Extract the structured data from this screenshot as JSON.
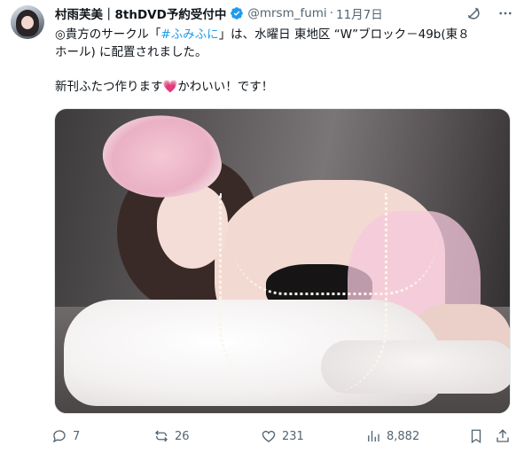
{
  "tweet": {
    "display_name": "村雨芙美｜8thDVD予約受付中",
    "handle": "@mrsm_fumi",
    "separator": "·",
    "date": "11月7日",
    "text_line1_prefix": "◎貴方のサークル「",
    "hashtag": "#ふみふに",
    "text_line1_suffix": "」は、水曜日 東地区 “W”ブロック－49b(東８",
    "text_line2": "ホール) に配置されました。",
    "text_line3_prefix": "新刊ふたつ作ります",
    "heart_emoji": "💗",
    "text_line3_suffix": "かわいい！です！",
    "media_alt": ""
  },
  "header_icons": [
    "grok-icon",
    "more-icon"
  ],
  "actions": {
    "replies": "7",
    "reposts": "26",
    "likes": "231",
    "views": "8,882"
  },
  "colors": {
    "text": "#0f1419",
    "muted": "#536471",
    "link": "#1d9bf0",
    "verified": "#1d9bf0"
  }
}
